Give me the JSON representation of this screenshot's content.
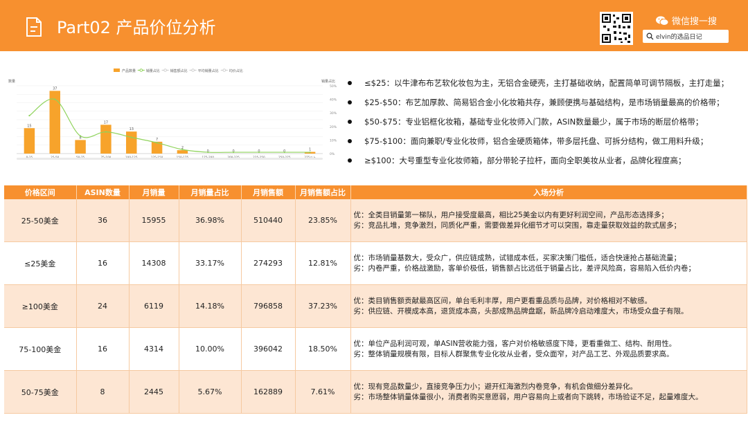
{
  "header": {
    "title": "Part02 产品价位分析",
    "wechat_label": "微信搜一搜",
    "search_text": "elvin的选品日记"
  },
  "bullets": [
    "≤$25：以牛津布布艺软化妆包为主，无铝合金硬壳，主打基础收纳，配置简单可调节隔板，主打走量；",
    "$25-$50：布艺加厚款、简易铝合金小化妆箱共存，兼顾便携与基础结构，是市场销量最高的价格带；",
    "$50-$75：专业铝框化妆箱，基础专业化妆师入门款，ASIN数量最少，属于市场的断层价格带；",
    "$75-$100：面向兼职/专业化妆师，铝合金硬质箱体，带多层托盘、可拆分结构，做工用料升级；",
    "≥$100：大号重型专业化妆师箱，部分带轮子拉杆，面向全职美妆从业者，品牌化程度高；"
  ],
  "table": {
    "headers": [
      "价格区间",
      "ASIN数量",
      "月销量",
      "月销量占比",
      "月销售额",
      "月销售额占比",
      "入场分析"
    ],
    "rows": [
      {
        "range": "25-50美金",
        "asin": "36",
        "sales": "15955",
        "sales_pct": "36.98%",
        "revenue": "510440",
        "revenue_pct": "23.85%",
        "pro": "优：全类目销量第一梯队，用户接受度最高，相比25美金以内有更好利润空间，产品形态选择多；",
        "con": "劣：竞品扎堆，竞争激烈，同质化严重，需要做差异化细节才可以突围，靠走量获取效益的款式居多；"
      },
      {
        "range": "≤25美金",
        "asin": "16",
        "sales": "14308",
        "sales_pct": "33.17%",
        "revenue": "274293",
        "revenue_pct": "12.81%",
        "pro": "优：市场销量基数大，受众广，供应链成熟，试错成本低，买家决策门槛低，适合快速抢占基础流量；",
        "con": "劣：内卷严重，价格战激励，客单价极低，销售额占比远低于销量占比，差评风险高，容易陷入低价内卷；"
      },
      {
        "range": "≥100美金",
        "asin": "24",
        "sales": "6119",
        "sales_pct": "14.18%",
        "revenue": "796858",
        "revenue_pct": "37.23%",
        "pro": "优：类目销售额贡献最高区间，单台毛利丰厚，用户更看重品质与品牌，对价格相对不敏感。",
        "con": "劣：供应链、开模成本高，退货成本高，头部成熟品牌盘踞，新品牌冷启动难度大，市场受众盘子有限。"
      },
      {
        "range": "75-100美金",
        "asin": "16",
        "sales": "4314",
        "sales_pct": "10.00%",
        "revenue": "396042",
        "revenue_pct": "18.50%",
        "pro": "优：单位产品利润可观，单ASIN营收能力强，客户对价格敏感度下降，更看重做工、结构、耐用性。",
        "con": "劣：整体销量规模有限，目标人群聚焦专业化妆从业者，受众面窄，对产品工艺、外观品质要求高。"
      },
      {
        "range": "50-75美金",
        "asin": "8",
        "sales": "2445",
        "sales_pct": "5.67%",
        "revenue": "162889",
        "revenue_pct": "7.61%",
        "pro": "优：现有竞品数量少，直接竞争压力小；避开红海激烈内卷竞争，有机会做细分差异化。",
        "con": "劣：市场整体销量体量很小，消费者购买意愿弱，用户容易向上或者向下跳转，市场验证不足，起量难度大。"
      }
    ]
  },
  "chart_data": {
    "type": "bar",
    "legend": [
      "产品数量",
      "销量占比",
      "销售额占比",
      "平均销量占比",
      "均价占比"
    ],
    "categories": [
      "0-25",
      "25-50",
      "50-75",
      "75-100",
      "100-125",
      "125-150",
      "150-175",
      "175-200",
      "200-225",
      "225-250",
      "250-275",
      "275以上"
    ],
    "series": [
      {
        "name": "产品数量",
        "values": [
          15,
          37,
          8,
          17,
          13,
          7,
          2,
          0,
          0,
          0,
          0,
          1
        ],
        "color": "#f7a32b"
      },
      {
        "name": "销量占比",
        "values": [
          28,
          40,
          13,
          16,
          12,
          8,
          3,
          1,
          1,
          1,
          1,
          1
        ],
        "color": "#8fd35b"
      }
    ],
    "ylabel": "数量",
    "y2label": "销量占比",
    "ylim": [
      0,
      40
    ],
    "y2lim": [
      0,
      50
    ],
    "yticks": [
      0,
      5,
      10,
      15,
      20,
      25,
      30,
      35,
      40
    ],
    "y2ticks": [
      "0%",
      "10%",
      "20%",
      "30%",
      "40%",
      "50%"
    ],
    "grid": true,
    "legend_position": "top-center"
  }
}
